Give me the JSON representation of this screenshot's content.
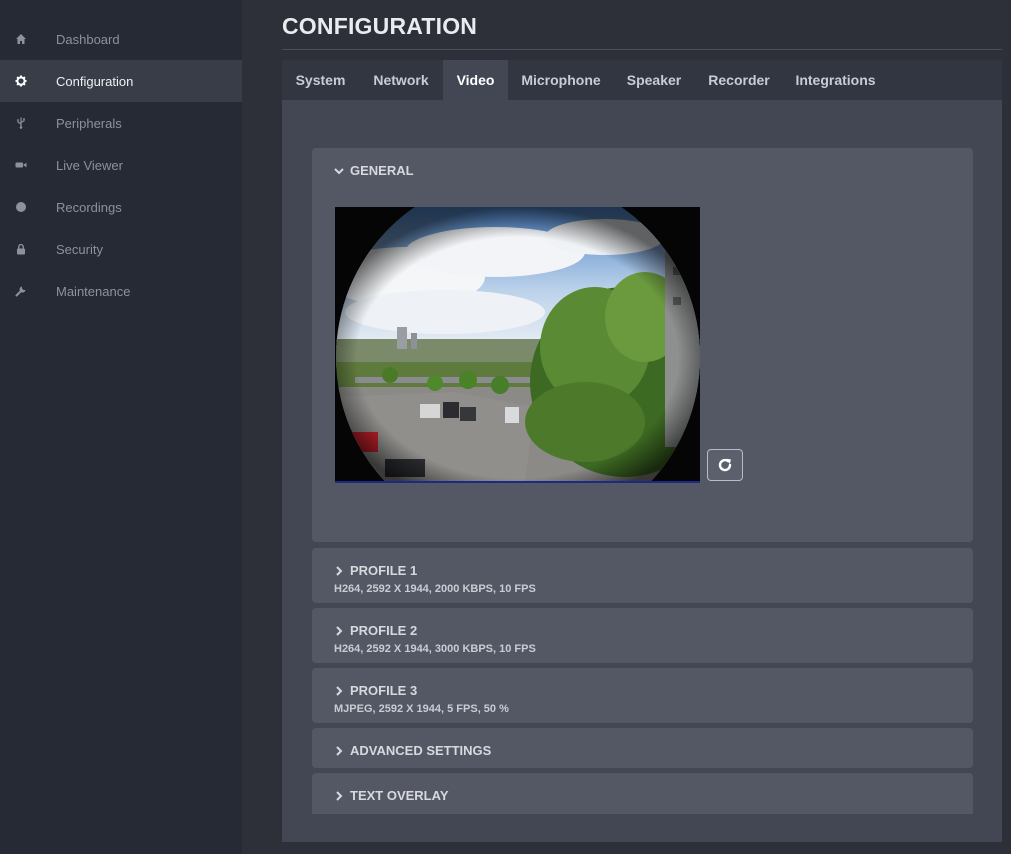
{
  "sidebar": {
    "items": [
      {
        "label": "Dashboard",
        "icon": "home-icon"
      },
      {
        "label": "Configuration",
        "icon": "gear-icon"
      },
      {
        "label": "Peripherals",
        "icon": "usb-icon"
      },
      {
        "label": "Live Viewer",
        "icon": "video-camera-icon"
      },
      {
        "label": "Recordings",
        "icon": "record-icon"
      },
      {
        "label": "Security",
        "icon": "lock-icon"
      },
      {
        "label": "Maintenance",
        "icon": "wrench-icon"
      }
    ],
    "active": "Configuration"
  },
  "page": {
    "title": "CONFIGURATION"
  },
  "tabs": [
    {
      "label": "System"
    },
    {
      "label": "Network"
    },
    {
      "label": "Video"
    },
    {
      "label": "Microphone"
    },
    {
      "label": "Speaker"
    },
    {
      "label": "Recorder"
    },
    {
      "label": "Integrations"
    }
  ],
  "active_tab": "Video",
  "general": {
    "label": "GENERAL",
    "expanded": true,
    "refresh_icon": "refresh-icon"
  },
  "sections": [
    {
      "label": "PROFILE 1",
      "summary": "H264, 2592 X 1944, 2000 KBPS, 10 FPS"
    },
    {
      "label": "PROFILE 2",
      "summary": "H264, 2592 X 1944, 3000 KBPS, 10 FPS"
    },
    {
      "label": "PROFILE 3",
      "summary": "MJPEG, 2592 X 1944, 5 FPS, 50 %"
    },
    {
      "label": "ADVANCED SETTINGS"
    },
    {
      "label": "TEXT OVERLAY"
    }
  ],
  "colors": {
    "background": "#2d3039",
    "sidebar": "#262a34",
    "panel": "#545865",
    "content": "#434753"
  }
}
